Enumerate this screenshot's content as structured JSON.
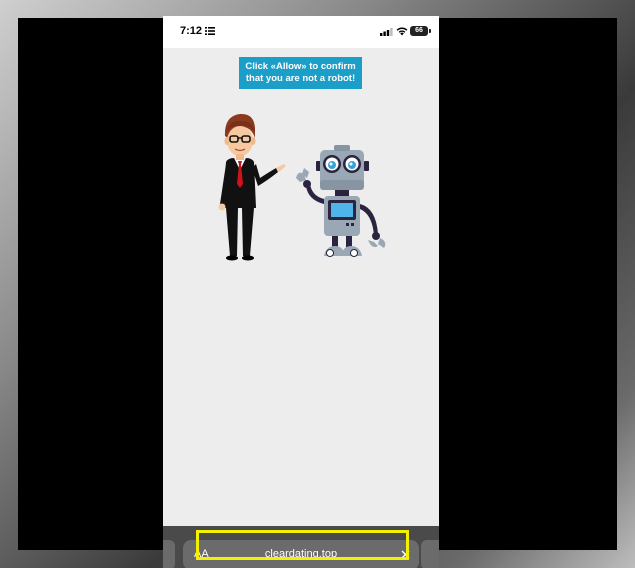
{
  "status_bar": {
    "time": "7:12",
    "battery": "66",
    "icons": [
      "list-icon",
      "signal-icon",
      "wifi-icon",
      "battery-icon"
    ]
  },
  "page": {
    "banner_line1": "Click «Allow» to confirm",
    "banner_line2": "that you are not a robot!",
    "illustration": "man-and-robot-illustration"
  },
  "browser_bar": {
    "aa_label": "AA",
    "url": "cleardating.top",
    "icons": [
      "close-icon"
    ]
  },
  "colors": {
    "banner": "#1b9fc8",
    "highlight": "#f3f000",
    "page_bg": "#ededed"
  }
}
